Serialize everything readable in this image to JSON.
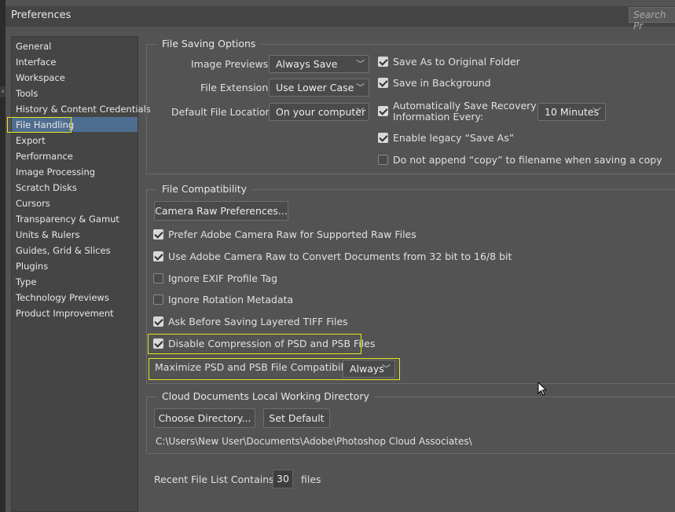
{
  "window": {
    "title": "Preferences",
    "search_placeholder": "Search Pr"
  },
  "sidebar": {
    "items": [
      {
        "label": "General"
      },
      {
        "label": "Interface"
      },
      {
        "label": "Workspace"
      },
      {
        "label": "Tools"
      },
      {
        "label": "History & Content Credentials"
      },
      {
        "label": "File Handling",
        "selected": true
      },
      {
        "label": "Export"
      },
      {
        "label": "Performance"
      },
      {
        "label": "Image Processing"
      },
      {
        "label": "Scratch Disks"
      },
      {
        "label": "Cursors"
      },
      {
        "label": "Transparency & Gamut"
      },
      {
        "label": "Units & Rulers"
      },
      {
        "label": "Guides, Grid & Slices"
      },
      {
        "label": "Plugins"
      },
      {
        "label": "Type"
      },
      {
        "label": "Technology Previews"
      },
      {
        "label": "Product Improvement"
      }
    ]
  },
  "file_saving": {
    "title": "File Saving Options",
    "image_previews_label": "Image Previews:",
    "image_previews_value": "Always Save",
    "file_extension_label": "File Extension:",
    "file_extension_value": "Use Lower Case",
    "default_location_label": "Default File Location:",
    "default_location_value": "On your computer",
    "save_as_original": {
      "label": "Save As to Original Folder",
      "checked": true
    },
    "save_in_background": {
      "label": "Save in Background",
      "checked": true
    },
    "auto_save": {
      "label_line1": "Automatically Save Recovery",
      "label_line2": "Information Every:",
      "checked": true,
      "value": "10 Minutes"
    },
    "legacy_save_as": {
      "label": "Enable legacy “Save As”",
      "checked": true
    },
    "no_copy_append": {
      "label": "Do not append “copy” to filename when saving a copy",
      "checked": false
    }
  },
  "file_compat": {
    "title": "File Compatibility",
    "camera_raw_button": "Camera Raw Preferences...",
    "options": [
      {
        "label": "Prefer Adobe Camera Raw for Supported Raw Files",
        "checked": true
      },
      {
        "label": "Use Adobe Camera Raw to Convert Documents from 32 bit to 16/8 bit",
        "checked": true
      },
      {
        "label": "Ignore EXIF Profile Tag",
        "checked": false
      },
      {
        "label": "Ignore Rotation Metadata",
        "checked": false
      },
      {
        "label": "Ask Before Saving Layered TIFF Files",
        "checked": true
      },
      {
        "label": "Disable Compression of PSD and PSB Files",
        "checked": true
      }
    ],
    "maximize_label": "Maximize PSD and PSB File Compatibility:",
    "maximize_value": "Always"
  },
  "cloud_docs": {
    "title": "Cloud Documents Local Working Directory",
    "choose_button": "Choose Directory...",
    "default_button": "Set Default",
    "path": "C:\\Users\\New User\\Documents\\Adobe\\Photoshop Cloud Associates\\"
  },
  "recent_files": {
    "label": "Recent File List Contains:",
    "value": "30",
    "suffix": "files"
  },
  "colors": {
    "highlight": "#e5e520",
    "selection": "#4f6d8f",
    "background": "#535353"
  }
}
